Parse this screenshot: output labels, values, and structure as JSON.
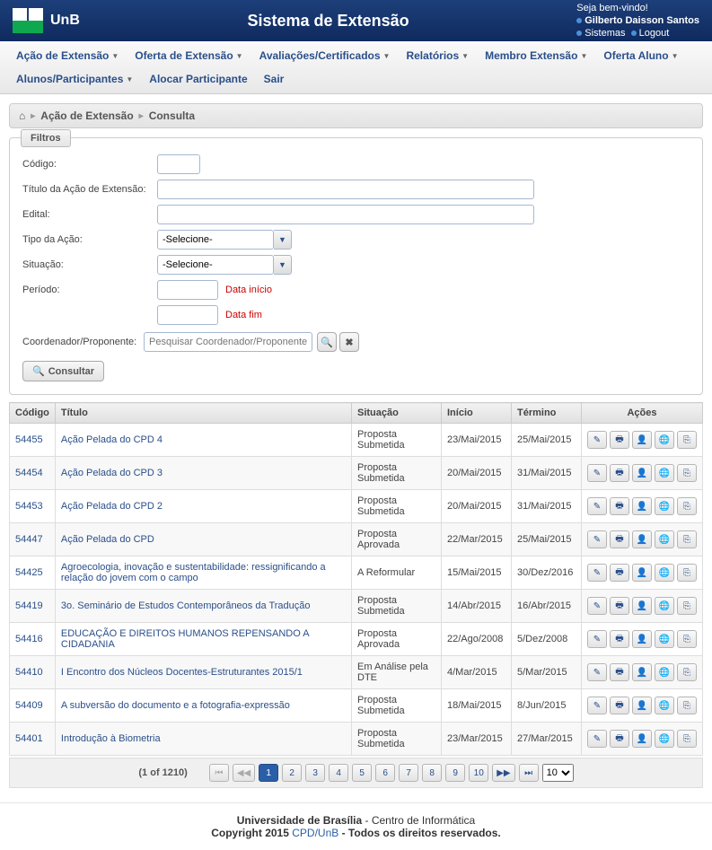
{
  "header": {
    "brand": "UnB",
    "system_title": "Sistema de Extensão",
    "welcome": "Seja bem-vindo!",
    "user_name": "Gilberto Daisson Santos",
    "link_sistemas": "Sistemas",
    "link_logout": "Logout"
  },
  "menu": [
    {
      "label": "Ação de Extensão",
      "drop": true
    },
    {
      "label": "Oferta de Extensão",
      "drop": true
    },
    {
      "label": "Avaliações/Certificados",
      "drop": true
    },
    {
      "label": "Relatórios",
      "drop": true
    },
    {
      "label": "Membro Extensão",
      "drop": true
    },
    {
      "label": "Oferta Aluno",
      "drop": true
    },
    {
      "label": "Alunos/Participantes",
      "drop": true
    },
    {
      "label": "Alocar Participante",
      "drop": false
    },
    {
      "label": "Sair",
      "drop": false
    }
  ],
  "breadcrumb": {
    "l1": "Ação de Extensão",
    "l2": "Consulta"
  },
  "filters": {
    "legend": "Filtros",
    "codigo": "Código:",
    "titulo": "Título da Ação de Extensão:",
    "edital": "Edital:",
    "tipo": "Tipo da Ação:",
    "situacao": "Situação:",
    "periodo": "Período:",
    "coord": "Coordenador/Proponente:",
    "selec": "-Selecione-",
    "data_ini": "Data início",
    "data_fim": "Data fim",
    "coord_ph": "Pesquisar Coordenador/Proponente.",
    "consultar": "Consultar"
  },
  "cols": {
    "codigo": "Código",
    "titulo": "Título",
    "situacao": "Situação",
    "inicio": "Início",
    "termino": "Término",
    "acoes": "Ações"
  },
  "rows": [
    {
      "c": "54455",
      "t": "Ação Pelada do CPD 4",
      "s": "Proposta Submetida",
      "i": "23/Mai/2015",
      "f": "25/Mai/2015"
    },
    {
      "c": "54454",
      "t": "Ação Pelada do CPD 3",
      "s": "Proposta Submetida",
      "i": "20/Mai/2015",
      "f": "31/Mai/2015"
    },
    {
      "c": "54453",
      "t": "Ação Pelada do CPD 2",
      "s": "Proposta Submetida",
      "i": "20/Mai/2015",
      "f": "31/Mai/2015"
    },
    {
      "c": "54447",
      "t": "Ação Pelada do CPD",
      "s": "Proposta Aprovada",
      "i": "22/Mar/2015",
      "f": "25/Mai/2015"
    },
    {
      "c": "54425",
      "t": "Agroecologia, inovação e sustentabilidade: ressignificando a relação do jovem com o campo",
      "s": "A Reformular",
      "i": "15/Mai/2015",
      "f": "30/Dez/2016"
    },
    {
      "c": "54419",
      "t": "3o. Seminário de Estudos Contemporâneos da Tradução",
      "s": "Proposta Submetida",
      "i": "14/Abr/2015",
      "f": "16/Abr/2015"
    },
    {
      "c": "54416",
      "t": "EDUCAÇÃO E DIREITOS HUMANOS REPENSANDO A CIDADANIA",
      "s": "Proposta Aprovada",
      "i": "22/Ago/2008",
      "f": "5/Dez/2008"
    },
    {
      "c": "54410",
      "t": "I Encontro dos Núcleos Docentes-Estruturantes 2015/1",
      "s": "Em Análise pela DTE",
      "i": "4/Mar/2015",
      "f": "5/Mar/2015"
    },
    {
      "c": "54409",
      "t": "A subversão do documento e a fotografia-expressão",
      "s": "Proposta Submetida",
      "i": "18/Mai/2015",
      "f": "8/Jun/2015"
    },
    {
      "c": "54401",
      "t": "Introdução à Biometria",
      "s": "Proposta Submetida",
      "i": "23/Mar/2015",
      "f": "27/Mar/2015"
    }
  ],
  "paginator": {
    "info": "(1 of 1210)",
    "pages": [
      "1",
      "2",
      "3",
      "4",
      "5",
      "6",
      "7",
      "8",
      "9",
      "10"
    ],
    "per": "10"
  },
  "footer": {
    "l1a": "Universidade de Brasília",
    "l1b": " - Centro de Informática",
    "l2a": "Copyright 2015 ",
    "l2b": "CPD/UnB",
    "l2c": " - Todos os direitos reservados."
  },
  "icons": {
    "search": "🔍",
    "clear": "✖",
    "edit": "✎",
    "print": "🖶",
    "user": "👤",
    "globe": "🌐",
    "link": "⎘"
  }
}
